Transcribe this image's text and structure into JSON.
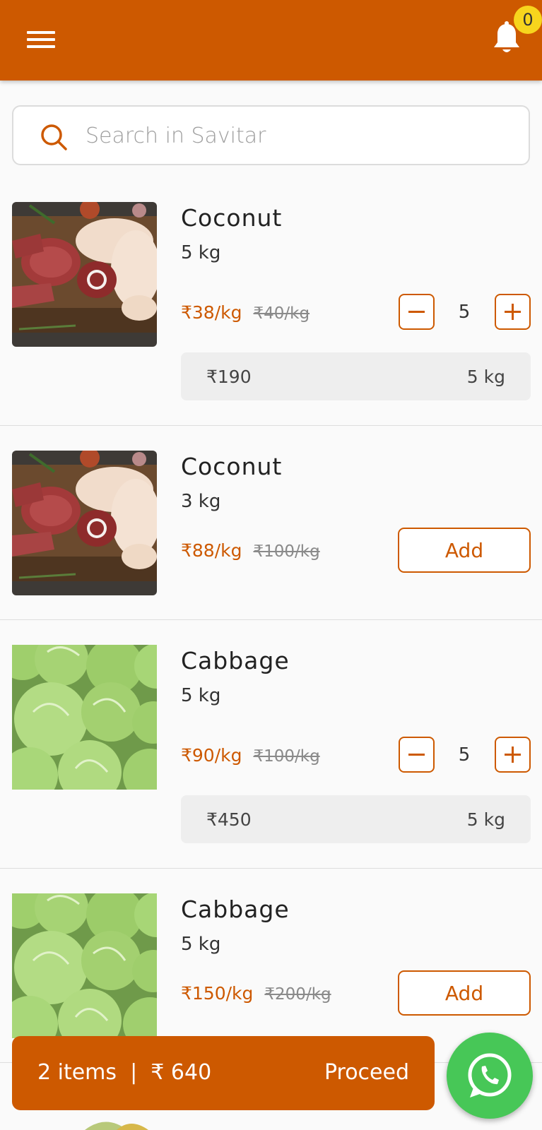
{
  "header": {
    "notification_count": "0"
  },
  "search": {
    "placeholder": "Search in Savitar"
  },
  "products": [
    {
      "name": "Coconut",
      "weight": "5 kg",
      "price": "₹38/kg",
      "mrp": "₹40/kg",
      "qty": "5",
      "total": "₹190",
      "total_qty": "5 kg",
      "image": "meat-platter"
    },
    {
      "name": "Coconut",
      "weight": "3 kg",
      "price": "₹88/kg",
      "mrp": "₹100/kg",
      "add_label": "Add",
      "image": "meat-platter"
    },
    {
      "name": "Cabbage",
      "weight": "5 kg",
      "price": "₹90/kg",
      "mrp": "₹100/kg",
      "qty": "5",
      "total": "₹450",
      "total_qty": "5 kg",
      "image": "cabbages"
    },
    {
      "name": "Cabbage",
      "weight": "5 kg",
      "price": "₹150/kg",
      "mrp": "₹200/kg",
      "add_label": "Add",
      "image": "cabbages"
    }
  ],
  "cart": {
    "summary": "2 items  |  ₹ 640",
    "proceed_label": "Proceed"
  },
  "icons": [
    "menu-icon",
    "bell-icon",
    "search-icon",
    "minus-icon",
    "plus-icon",
    "whatsapp-icon"
  ],
  "colors": {
    "primary": "#cd5900",
    "badge": "#f7d51d",
    "whatsapp": "#47c757"
  }
}
